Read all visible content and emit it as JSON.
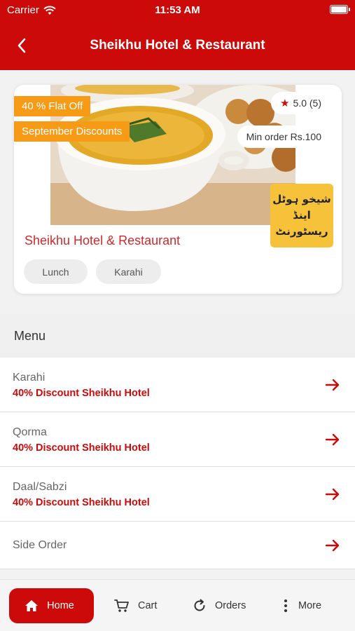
{
  "status_bar": {
    "carrier": "Carrier",
    "time": "11:53 AM"
  },
  "header": {
    "title": "Sheikhu Hotel & Restaurant"
  },
  "restaurant": {
    "badges": [
      "40 % Flat Off",
      "September Discounts"
    ],
    "rating": "5.0 (5)",
    "min_order": "Min order Rs.100",
    "urdu_logo": [
      "شیخو ہوٹل",
      "اینڈ",
      "ریسٹورنٹ"
    ],
    "name": "Sheikhu Hotel & Restaurant",
    "tags": [
      "Lunch",
      "Karahi"
    ]
  },
  "menu": {
    "title": "Menu",
    "items": [
      {
        "name": "Karahi",
        "subtitle": "40% Discount Sheikhu Hotel"
      },
      {
        "name": "Qorma",
        "subtitle": "40% Discount Sheikhu Hotel"
      },
      {
        "name": "Daal/Sabzi",
        "subtitle": "40% Discount Sheikhu Hotel"
      },
      {
        "name": "Side Order"
      }
    ]
  },
  "bottom_nav": {
    "home": "Home",
    "cart": "Cart",
    "orders": "Orders",
    "more": "More"
  },
  "colors": {
    "primary": "#cd0a0a",
    "badge": "#f79a16",
    "logo_bg": "#f5c23a"
  }
}
